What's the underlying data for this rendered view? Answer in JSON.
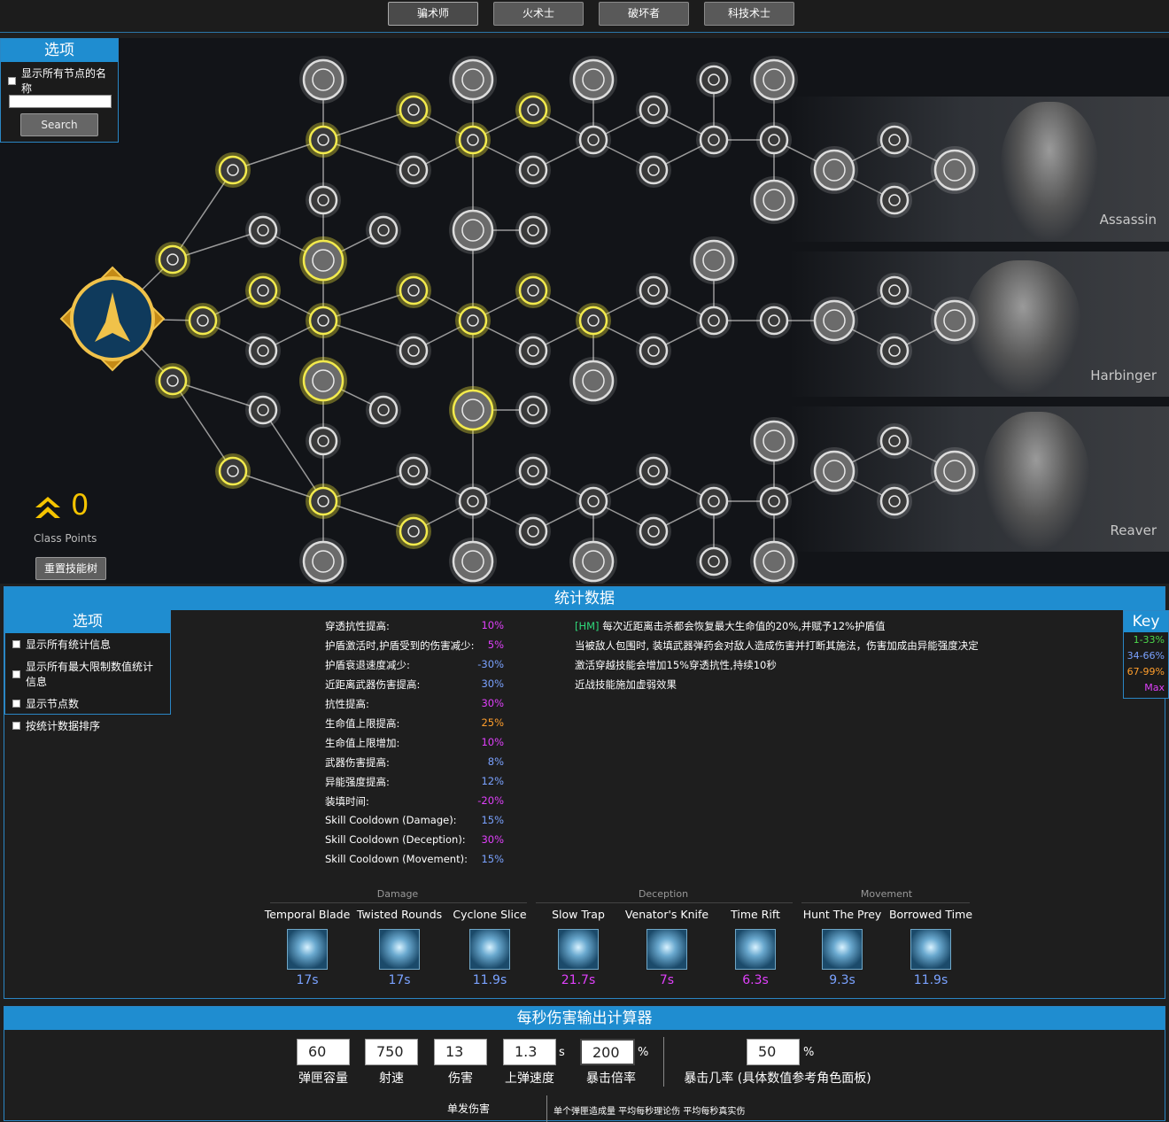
{
  "class_tabs": [
    "骗术师",
    "火术士",
    "破坏者",
    "科技术士"
  ],
  "tree_options": {
    "title": "选项",
    "show_names_label": "显示所有节点的名称",
    "search_button": "Search"
  },
  "subclasses": [
    "Assassin",
    "Harbinger",
    "Reaver"
  ],
  "class_points": {
    "value": "0",
    "label": "Class Points",
    "reset_button": "重置技能树"
  },
  "stats": {
    "title": "统计数据",
    "options_title": "选项",
    "options": [
      "显示所有统计信息",
      "显示所有最大限制数值统计信息",
      "显示节点数",
      "按统计数据排序"
    ],
    "rows": [
      {
        "label": "穿透抗性提高:",
        "value": "10%",
        "color": "#e040fb"
      },
      {
        "label": "护盾激活时,护盾受到的伤害减少:",
        "value": "5%",
        "color": "#e040fb"
      },
      {
        "label": "护盾衰退速度减少:",
        "value": "-30%",
        "color": "#7aa2ff"
      },
      {
        "label": "近距离武器伤害提高:",
        "value": "30%",
        "color": "#7aa2ff"
      },
      {
        "label": "抗性提高:",
        "value": "30%",
        "color": "#e040fb"
      },
      {
        "label": "生命值上限提高:",
        "value": "25%",
        "color": "#ff9e2c"
      },
      {
        "label": "生命值上限增加:",
        "value": "10%",
        "color": "#e040fb"
      },
      {
        "label": "武器伤害提高:",
        "value": "8%",
        "color": "#7aa2ff"
      },
      {
        "label": "异能强度提高:",
        "value": "12%",
        "color": "#7aa2ff"
      },
      {
        "label": "装填时间:",
        "value": "-20%",
        "color": "#e040fb"
      },
      {
        "label": "Skill Cooldown (Damage):",
        "value": "15%",
        "color": "#7aa2ff"
      },
      {
        "label": "Skill Cooldown (Deception):",
        "value": "30%",
        "color": "#e040fb"
      },
      {
        "label": "Skill Cooldown (Movement):",
        "value": "15%",
        "color": "#7aa2ff"
      }
    ],
    "effects": {
      "hm_tag": "[HM]",
      "first": " 每次近距离击杀都会恢复最大生命值的20%,并赋予12%护盾值",
      "lines": [
        "当被敌人包围时, 装填武器弹药会对敌人造成伤害并打断其施法，伤害加成由异能强度决定",
        "激活穿越技能会增加15%穿透抗性,持续10秒",
        "近战技能施加虚弱效果"
      ]
    },
    "key": {
      "title": "Key",
      "items": [
        {
          "label": "1-33%",
          "color": "#4cd94c"
        },
        {
          "label": "34-66%",
          "color": "#7aa2ff"
        },
        {
          "label": "67-99%",
          "color": "#ff9e2c"
        },
        {
          "label": "Max",
          "color": "#e040fb"
        }
      ]
    },
    "categories": [
      "Damage",
      "Deception",
      "Movement"
    ],
    "skills": [
      {
        "name": "Temporal Blade",
        "cooldown": "17s",
        "color": "#7aa2ff"
      },
      {
        "name": "Twisted Rounds",
        "cooldown": "17s",
        "color": "#7aa2ff"
      },
      {
        "name": "Cyclone Slice",
        "cooldown": "11.9s",
        "color": "#7aa2ff"
      },
      {
        "name": "Slow Trap",
        "cooldown": "21.7s",
        "color": "#e040fb"
      },
      {
        "name": "Venator's Knife",
        "cooldown": "7s",
        "color": "#e040fb"
      },
      {
        "name": "Time Rift",
        "cooldown": "6.3s",
        "color": "#e040fb"
      },
      {
        "name": "Hunt The Prey",
        "cooldown": "9.3s",
        "color": "#7aa2ff"
      },
      {
        "name": "Borrowed Time",
        "cooldown": "11.9s",
        "color": "#7aa2ff"
      }
    ]
  },
  "dps": {
    "title": "每秒伤害输出计算器",
    "fields": [
      {
        "label": "弹匣容量",
        "value": "60"
      },
      {
        "label": "射速",
        "value": "750"
      },
      {
        "label": "伤害",
        "value": "13"
      },
      {
        "label": "上弹速度",
        "value": "1.3",
        "unit": "s"
      },
      {
        "label": "暴击倍率",
        "value": "200",
        "unit": "%"
      },
      {
        "label": "暴击几率 (具体数值参考角色面板)",
        "value": "50",
        "unit": "%"
      }
    ],
    "sub_left": "单发伤害",
    "sub_right": "单个弹匣造成量   平均每秒理论伤   平均每秒真实伤"
  }
}
